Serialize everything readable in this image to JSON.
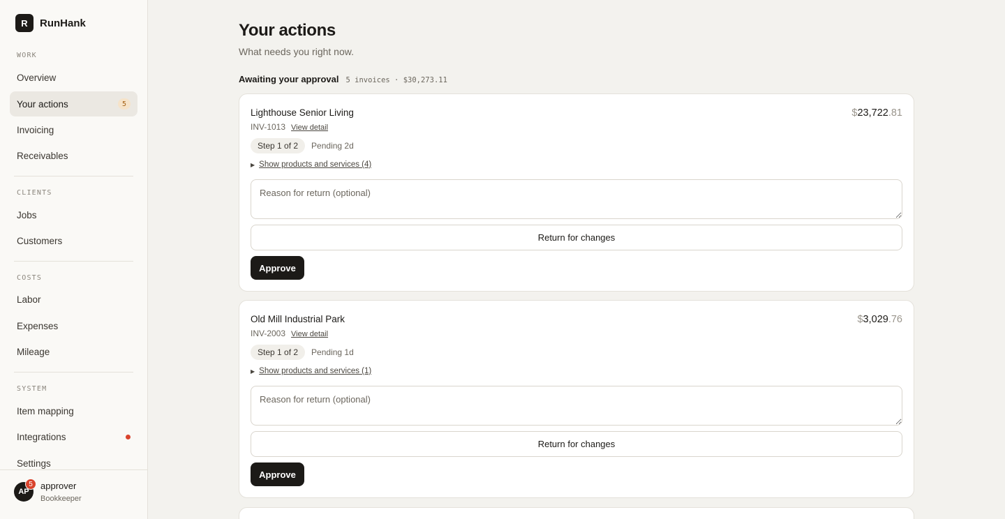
{
  "brand": {
    "mark": "R",
    "name": "RunHank"
  },
  "sidebar": {
    "sections": [
      {
        "title": "WORK",
        "items": [
          {
            "label": "Overview"
          },
          {
            "label": "Your actions",
            "badge": "5",
            "active": true
          },
          {
            "label": "Invoicing"
          },
          {
            "label": "Receivables"
          }
        ]
      },
      {
        "title": "CLIENTS",
        "items": [
          {
            "label": "Jobs"
          },
          {
            "label": "Customers"
          }
        ]
      },
      {
        "title": "COSTS",
        "items": [
          {
            "label": "Labor"
          },
          {
            "label": "Expenses"
          },
          {
            "label": "Mileage"
          }
        ]
      },
      {
        "title": "SYSTEM",
        "items": [
          {
            "label": "Item mapping"
          },
          {
            "label": "Integrations",
            "alert_dot": true
          },
          {
            "label": "Settings"
          }
        ]
      }
    ]
  },
  "user": {
    "initials": "AP",
    "notifications": "5",
    "name": "approver",
    "role": "Bookkeeper"
  },
  "page": {
    "title": "Your actions",
    "subtitle": "What needs you right now.",
    "section": {
      "title": "Awaiting your approval",
      "meta": "5 invoices · $30,273.11"
    }
  },
  "cards": [
    {
      "customer": "Lighthouse Senior Living",
      "amount_currency": "$",
      "amount_whole": "23,722",
      "amount_cents": ".81",
      "invoice": "INV-1013",
      "link": "View detail",
      "step": "Step 1 of 2",
      "pending": "Pending 2d",
      "toggle": "Show products and services (4)",
      "reason_placeholder": "Reason for return (optional)",
      "return_label": "Return for changes",
      "approve_label": "Approve"
    },
    {
      "customer": "Old Mill Industrial Park",
      "amount_currency": "$",
      "amount_whole": "3,029",
      "amount_cents": ".76",
      "invoice": "INV-2003",
      "link": "View detail",
      "step": "Step 1 of 2",
      "pending": "Pending 1d",
      "toggle": "Show products and services (1)",
      "reason_placeholder": "Reason for return (optional)",
      "return_label": "Return for changes",
      "approve_label": "Approve"
    }
  ],
  "colors": {
    "accent": "#1c1a17",
    "badge_bg": "#f6e3c9",
    "alert": "#d9432c",
    "page_bg": "#f3f2ee"
  },
  "icons": {
    "toggle": "triangle-right-icon"
  }
}
